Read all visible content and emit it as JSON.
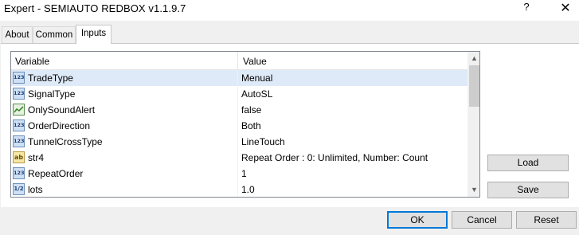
{
  "window": {
    "title": "Expert - SEMIAUTO REDBOX v1.1.9.7",
    "help_label": "?",
    "close_label": "✕"
  },
  "tabs": [
    {
      "label": "About",
      "active": false
    },
    {
      "label": "Common",
      "active": false
    },
    {
      "label": "Inputs",
      "active": true
    }
  ],
  "grid": {
    "columns": {
      "variable": "Variable",
      "value": "Value"
    },
    "rows": [
      {
        "icon": "integer-icon",
        "name": "TradeType",
        "value": "Menual",
        "selected": true
      },
      {
        "icon": "integer-icon",
        "name": "SignalType",
        "value": "AutoSL",
        "selected": false
      },
      {
        "icon": "boolean-icon",
        "name": "OnlySoundAlert",
        "value": "false",
        "selected": false
      },
      {
        "icon": "integer-icon",
        "name": "OrderDirection",
        "value": "Both",
        "selected": false
      },
      {
        "icon": "integer-icon",
        "name": "TunnelCrossType",
        "value": "LineTouch",
        "selected": false
      },
      {
        "icon": "string-icon",
        "name": "str4",
        "value": "Repeat Order :   0: Unlimited, Number: Count",
        "selected": false
      },
      {
        "icon": "integer-icon",
        "name": "RepeatOrder",
        "value": "1",
        "selected": false
      },
      {
        "icon": "double-icon",
        "name": "lots",
        "value": "1.0",
        "selected": false
      }
    ],
    "icon_glyphs": {
      "integer": "123",
      "double": "1/2",
      "string": "ab"
    }
  },
  "side_buttons": {
    "load": "Load",
    "save": "Save"
  },
  "footer_buttons": {
    "ok": "OK",
    "cancel": "Cancel",
    "reset": "Reset"
  },
  "colors": {
    "selected_row": "#dfeaf8",
    "default_button_border": "#0078d7"
  }
}
